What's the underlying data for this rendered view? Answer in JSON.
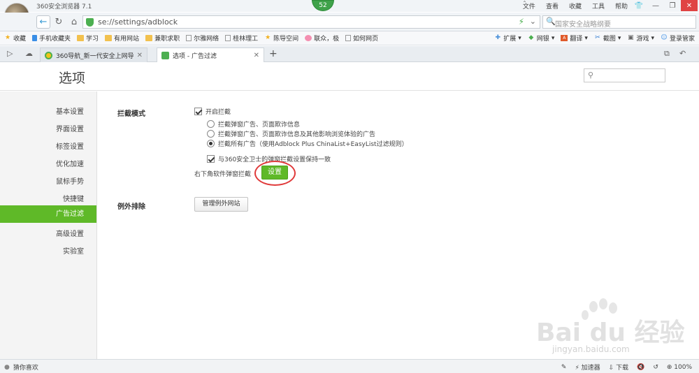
{
  "window": {
    "app_title": "360安全浏览器 7.1",
    "badge_count": "52",
    "menu": [
      "文件",
      "查看",
      "收藏",
      "工具",
      "帮助"
    ]
  },
  "addressbar": {
    "url": "se://settings/adblock",
    "search_placeholder": "国家安全战略纲要"
  },
  "bookmarks": {
    "left": [
      {
        "label": "收藏",
        "icon": "star-icon"
      },
      {
        "label": "手机收藏夹",
        "icon": "phone-icon"
      },
      {
        "label": "学习",
        "icon": "folder-icon"
      },
      {
        "label": "有用网站",
        "icon": "folder-icon"
      },
      {
        "label": "兼职求职",
        "icon": "folder-icon"
      },
      {
        "label": "尔雅网络",
        "icon": "page-icon"
      },
      {
        "label": "桂林理工",
        "icon": "page-icon"
      },
      {
        "label": "陈导空间",
        "icon": "star-icon"
      },
      {
        "label": "联众，极",
        "icon": "pig-icon"
      },
      {
        "label": "如何网页",
        "icon": "page-icon"
      }
    ],
    "right": [
      {
        "label": "扩展",
        "icon": "puzzle-icon"
      },
      {
        "label": "网银",
        "icon": "shield-icon"
      },
      {
        "label": "翻译",
        "icon": "translate-icon"
      },
      {
        "label": "截图",
        "icon": "scissors-icon"
      },
      {
        "label": "游戏",
        "icon": "gamepad-icon"
      },
      {
        "label": "登录管家",
        "icon": "user-icon"
      }
    ]
  },
  "tabs": [
    {
      "title": "360导航_新一代安全上网导航",
      "active": false
    },
    {
      "title": "选项 - 广告过滤",
      "active": true
    }
  ],
  "page": {
    "title": "选项",
    "sidebar": [
      "基本设置",
      "界面设置",
      "标签设置",
      "优化加速",
      "鼠标手势",
      "快捷键",
      "广告过滤",
      "高级设置",
      "实验室"
    ],
    "active_sidebar": "广告过滤",
    "adblock": {
      "section_label": "拦截模式",
      "enable_label": "开启拦截",
      "enable_checked": true,
      "options": [
        {
          "label": "拦截弹窗广告、页面欺诈信息",
          "selected": false
        },
        {
          "label": "拦截弹窗广告、页面欺诈信息及其他影响浏览体验的广告",
          "selected": false
        },
        {
          "label": "拦截所有广告（使用Adblock Plus ChinaList+EasyList过滤规则）",
          "selected": true
        }
      ],
      "sync_label": "与360安全卫士的弹窗拦截设置保持一致",
      "sync_checked": true,
      "corner_label": "右下角软件弹窗拦截",
      "settings_button": "设置"
    },
    "exceptions": {
      "section_label": "例外排除",
      "manage_button": "管理例外网站"
    }
  },
  "watermark": {
    "text": "Bai du 经验",
    "sub": "jingyan.baidu.com"
  },
  "statusbar": {
    "left": "猜你喜欢",
    "accelerator": "加速器",
    "download": "下载",
    "zoom": "100%"
  }
}
